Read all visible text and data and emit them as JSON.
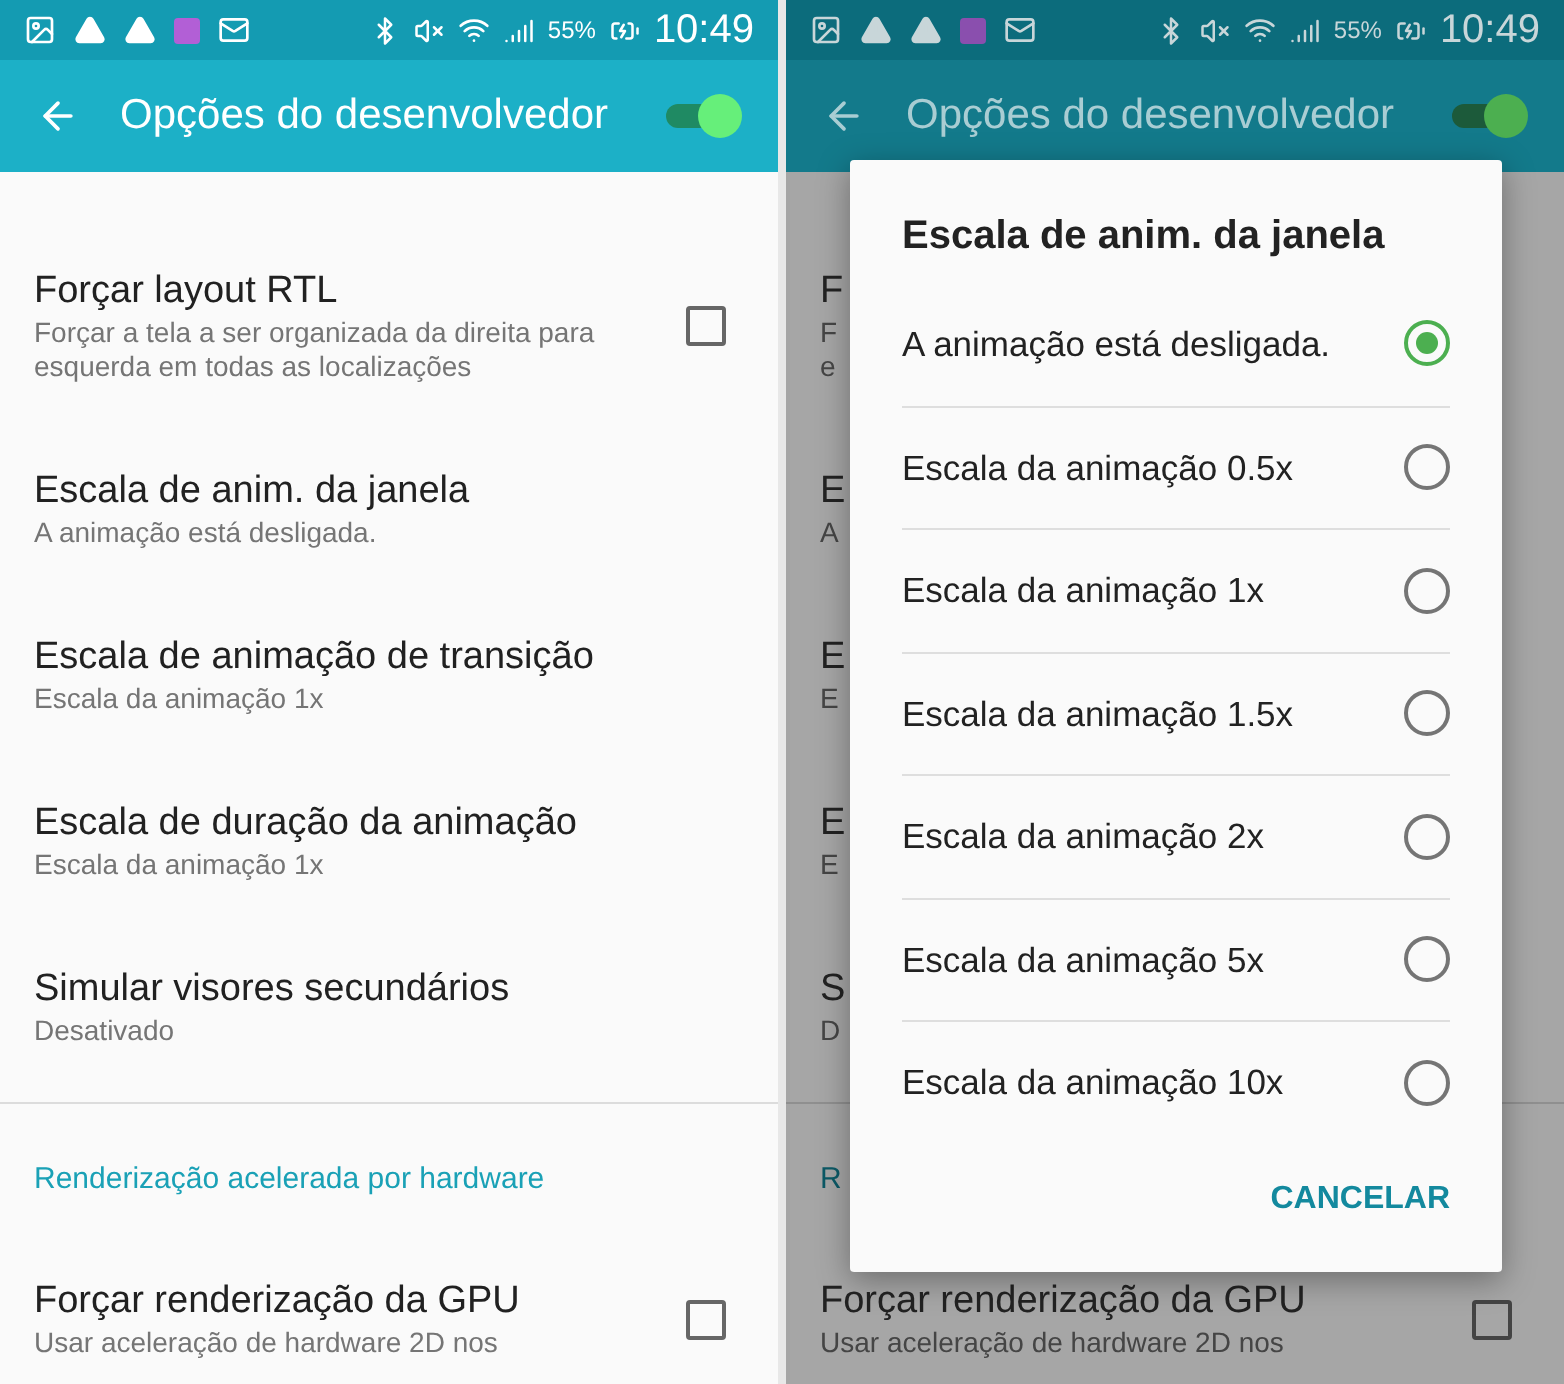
{
  "screens": [
    {
      "dimmed": false,
      "status_bar": {
        "battery": "55%",
        "time": "10:49"
      },
      "app_bar": {
        "title": "Opções do desenvolvedor",
        "switch_on": true
      },
      "list": [
        {
          "kind": "checkbox",
          "title": "Forçar layout RTL",
          "subtitle": [
            "Forçar a tela a ser organizada da direita para",
            "esquerda em todas as localizações"
          ],
          "checked": false
        },
        {
          "kind": "setting",
          "title": "Escala de anim. da janela",
          "subtitle": [
            "A animação está desligada."
          ]
        },
        {
          "kind": "setting",
          "title": "Escala de animação de transição",
          "subtitle": [
            "Escala da animação 1x"
          ]
        },
        {
          "kind": "setting",
          "title": "Escala de duração da animação",
          "subtitle": [
            "Escala da animação 1x"
          ]
        },
        {
          "kind": "setting",
          "title": "Simular visores secundários",
          "subtitle": [
            "Desativado"
          ]
        },
        {
          "kind": "category",
          "title": "Renderização acelerada por hardware"
        },
        {
          "kind": "checkbox",
          "title": "Forçar renderização da GPU",
          "subtitle": [
            "Usar aceleração de hardware 2D nos"
          ],
          "checked": false
        }
      ]
    },
    {
      "dimmed": true,
      "status_bar": {
        "battery": "55%",
        "time": "10:49"
      },
      "app_bar": {
        "title": "Opções do desenvolvedor",
        "switch_on": true
      },
      "list": [
        {
          "kind": "setting",
          "title": "F",
          "subtitle": [
            "F",
            "e"
          ]
        },
        {
          "kind": "setting",
          "title": "E",
          "subtitle": [
            "A"
          ]
        },
        {
          "kind": "setting",
          "title": "E",
          "subtitle": [
            "E"
          ]
        },
        {
          "kind": "setting",
          "title": "E",
          "subtitle": [
            "E"
          ]
        },
        {
          "kind": "setting",
          "title": "S",
          "subtitle": [
            "D"
          ]
        },
        {
          "kind": "category",
          "title": "R"
        },
        {
          "kind": "checkbox",
          "title": "Forçar renderização da GPU",
          "subtitle": [
            "Usar aceleração de hardware 2D nos"
          ],
          "checked": false
        }
      ],
      "dialog": {
        "title": "Escala de anim. da janela",
        "options": [
          {
            "label": "A animação está desligada.",
            "selected": true
          },
          {
            "label": "Escala da animação 0.5x",
            "selected": false
          },
          {
            "label": "Escala da animação 1x",
            "selected": false
          },
          {
            "label": "Escala da animação 1.5x",
            "selected": false
          },
          {
            "label": "Escala da animação 2x",
            "selected": false
          },
          {
            "label": "Escala da animação 5x",
            "selected": false
          },
          {
            "label": "Escala da animação 10x",
            "selected": false
          }
        ],
        "button": "CANCELAR"
      }
    }
  ]
}
